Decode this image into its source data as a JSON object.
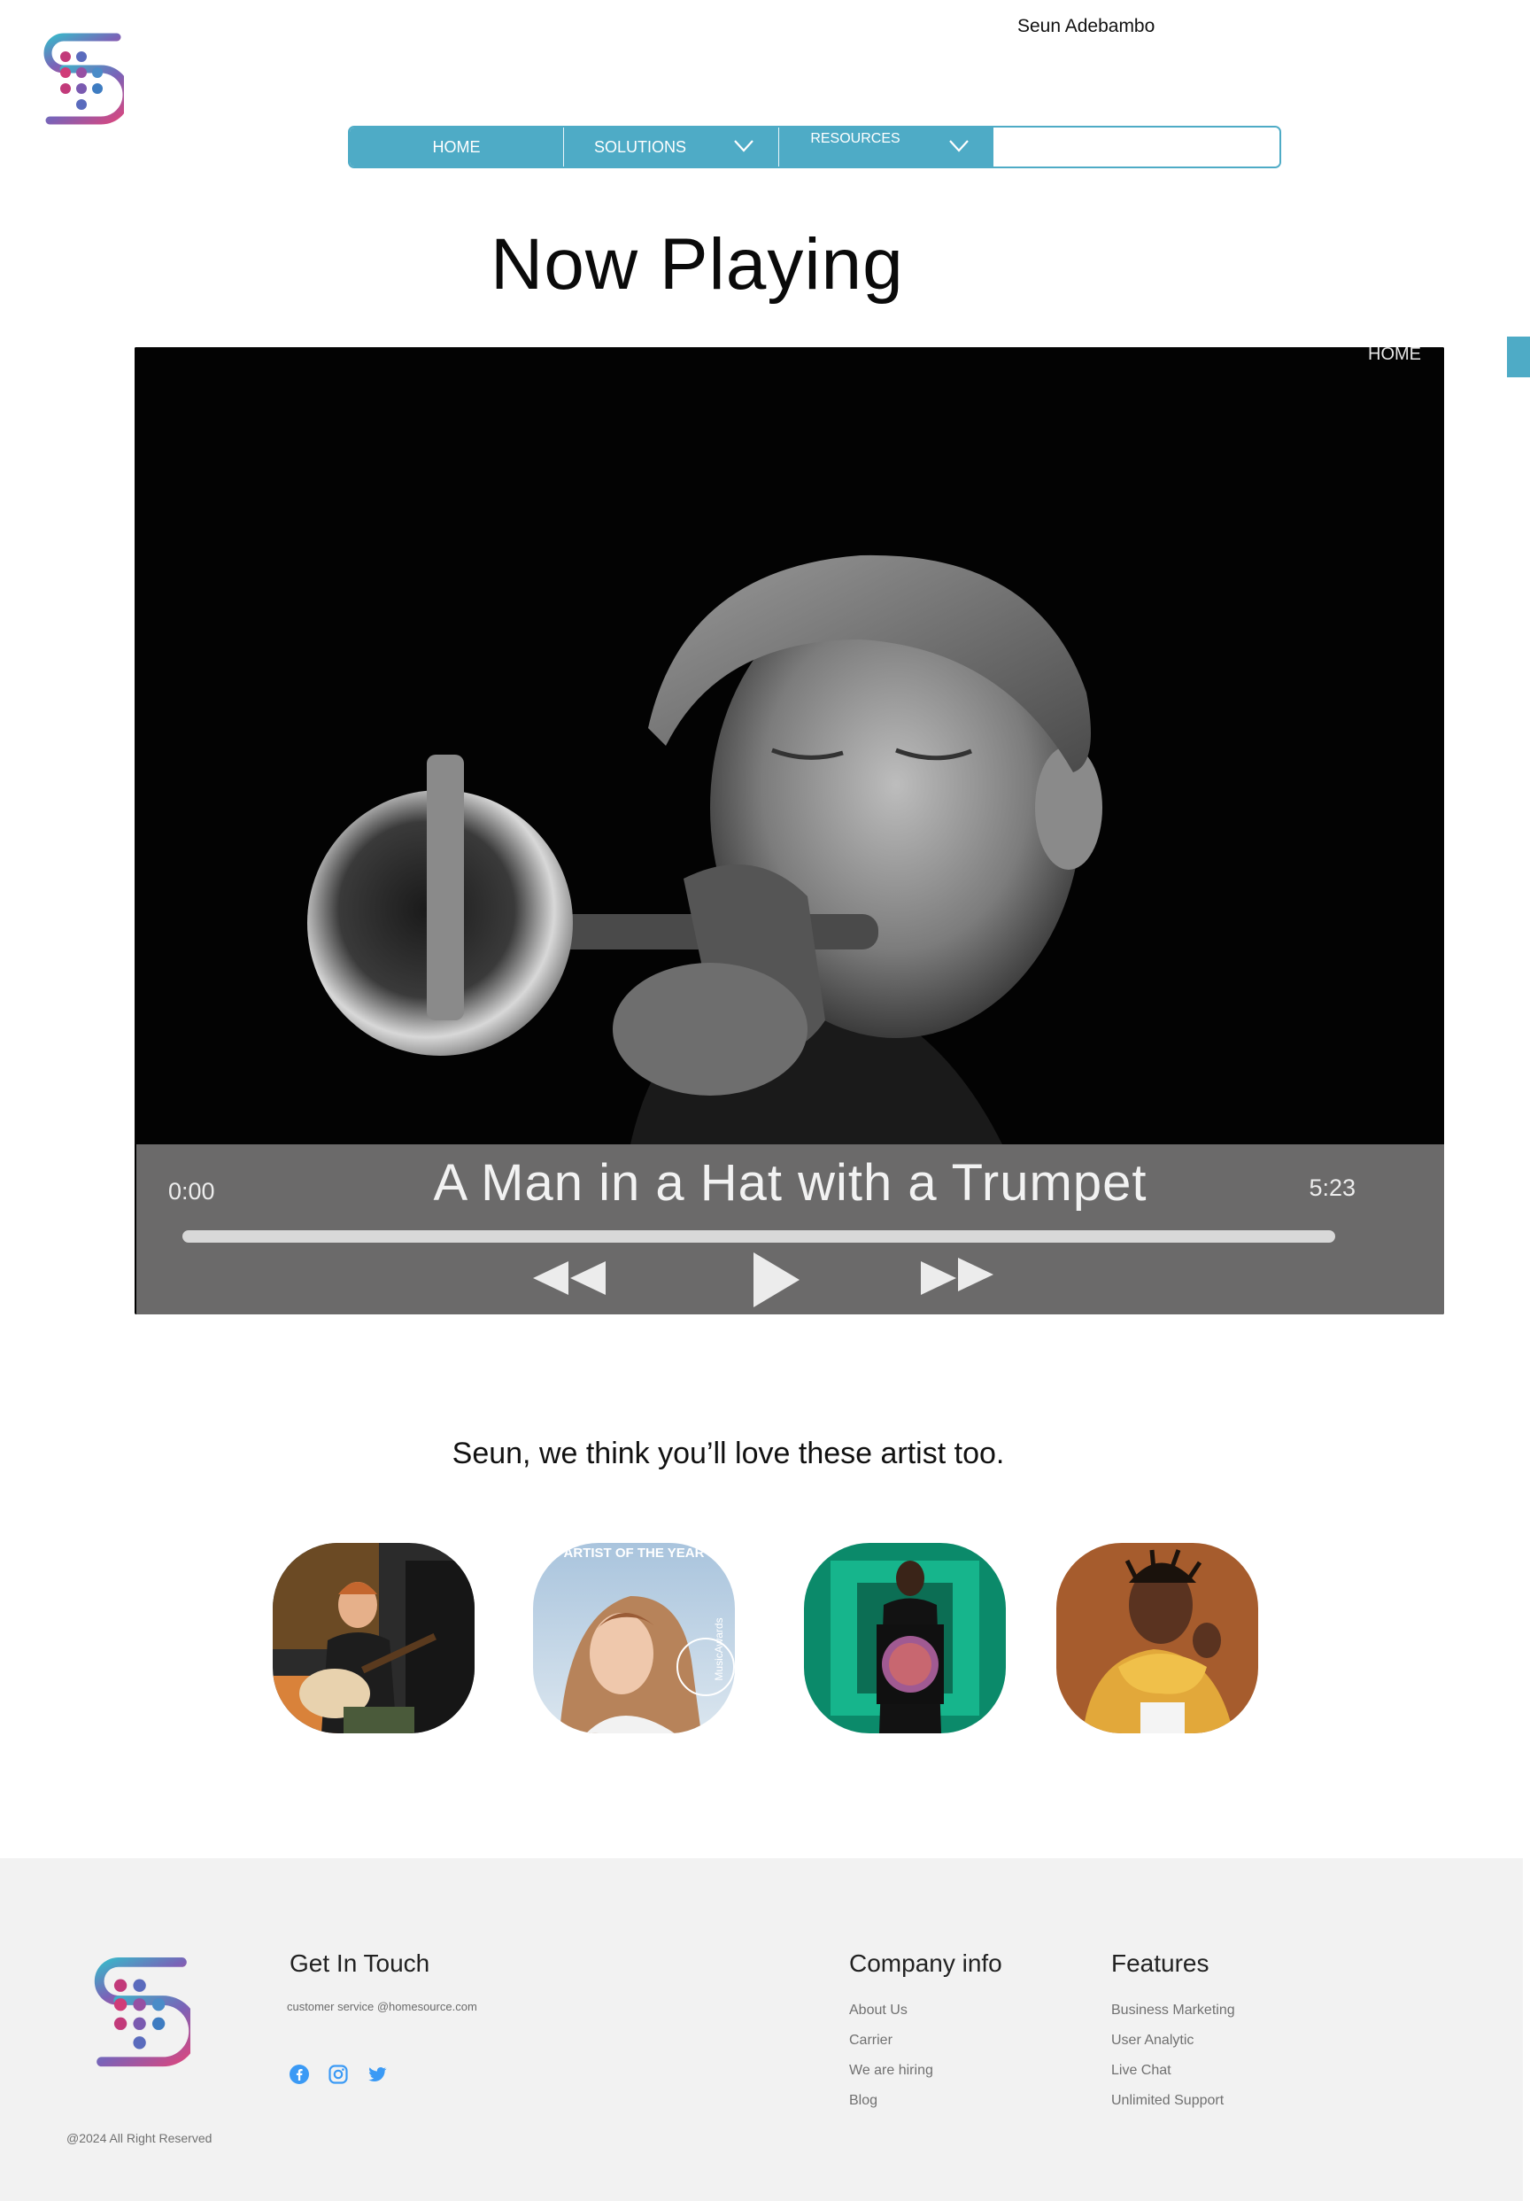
{
  "header": {
    "user_name": "Seun Adebambo",
    "nav": {
      "home": "HOME",
      "solutions": "SOLUTIONS",
      "resources": "RESOURCES",
      "search_value": ""
    }
  },
  "page_title": "Now Playing",
  "player": {
    "overlay_label": "HOME",
    "current_time": "0:00",
    "total_time": "5:23",
    "track_title": "A Man in a Hat with a Trumpet",
    "progress": 0
  },
  "recommendations": {
    "heading": "Seun, we think you’ll love these artist too.",
    "artists": [
      {
        "icon": "artist-guitarist-photo"
      },
      {
        "icon": "artist-of-the-year-photo",
        "badge_text": "ARTIST OF THE YEAR",
        "side_text": "MusicAwards"
      },
      {
        "icon": "artist-green-room-photo"
      },
      {
        "icon": "artist-yellow-jacket-photo"
      }
    ]
  },
  "footer": {
    "get_in_touch": "Get In Touch",
    "email": "customer service @homesource.com",
    "company_title": "Company info",
    "company_links": [
      "About Us",
      "Carrier",
      "We are hiring",
      "Blog"
    ],
    "features_title": "Features",
    "feature_links": [
      "Business Marketing",
      "User Analytic",
      "Live Chat",
      "Unlimited Support"
    ],
    "copyright": "@2024 All Right Reserved",
    "socials": [
      "facebook-icon",
      "instagram-icon",
      "twitter-icon"
    ]
  },
  "colors": {
    "accent": "#4eabc6",
    "social": "#3b9af5",
    "control_bar": "#6b6a6a",
    "footer_bg": "#f2f2f2"
  }
}
